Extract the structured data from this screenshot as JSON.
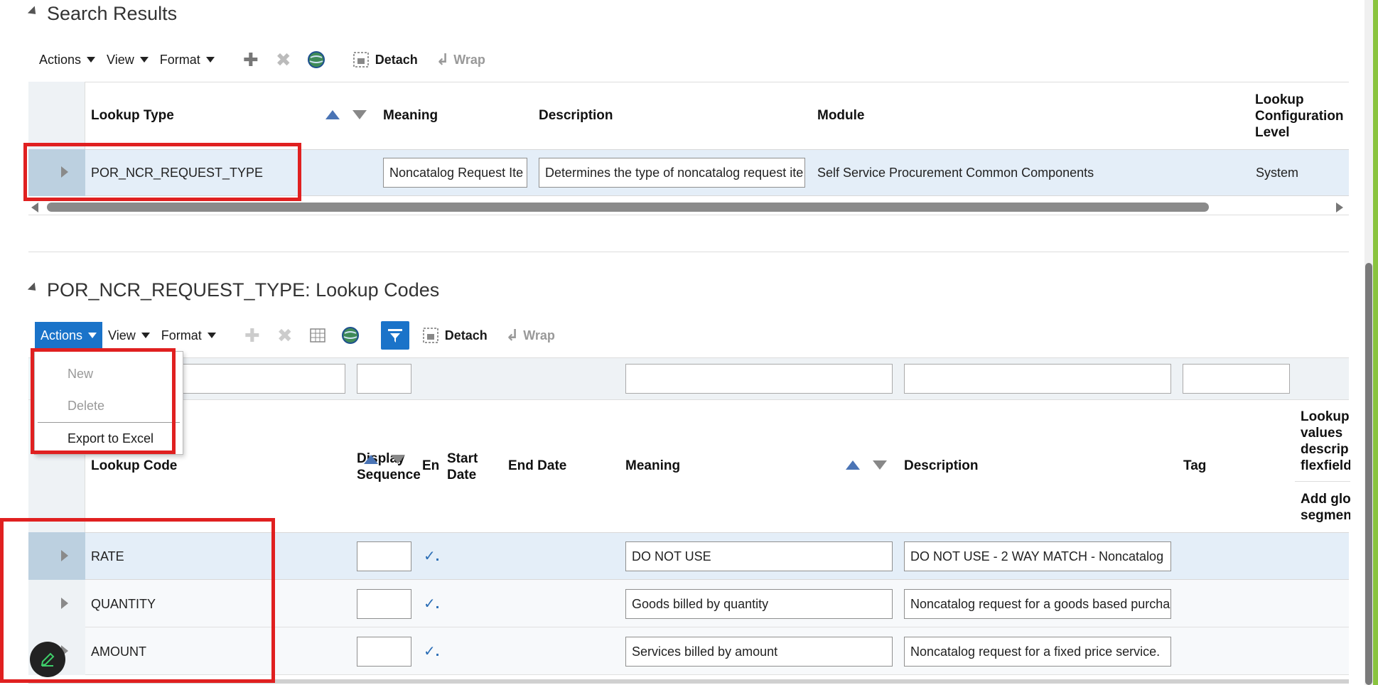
{
  "search_results": {
    "title": "Search Results",
    "toolbar": {
      "actions": "Actions",
      "view": "View",
      "format": "Format",
      "detach": "Detach",
      "wrap": "Wrap"
    },
    "columns": {
      "lookup_type": "Lookup Type",
      "meaning": "Meaning",
      "description": "Description",
      "module": "Module",
      "level_1": "Lookup",
      "level_2": "Configuration",
      "level_3": "Level"
    },
    "row": {
      "lookup_type": "POR_NCR_REQUEST_TYPE",
      "meaning": "Noncatalog Request Ite",
      "description": "Determines the type of noncatalog request ite",
      "module": "Self Service Procurement Common Components",
      "level": "System"
    }
  },
  "lookup_codes": {
    "title": "POR_NCR_REQUEST_TYPE: Lookup Codes",
    "toolbar": {
      "actions": "Actions",
      "view": "View",
      "format": "Format",
      "detach": "Detach",
      "wrap": "Wrap"
    },
    "actions_menu": {
      "new": "New",
      "delete": "Delete",
      "export": "Export to Excel"
    },
    "columns": {
      "lookup_code": "Lookup Code",
      "display_seq_1": "Display",
      "display_seq_2": "Sequence",
      "enabled": "En",
      "start_date_1": "Start",
      "start_date_2": "Date",
      "end_date": "End Date",
      "meaning": "Meaning",
      "description": "Description",
      "tag": "Tag",
      "flex_1": "Lookup",
      "flex_2": "values",
      "flex_3": "descrip",
      "flex_4": "flexfield",
      "flex_5": "Add glo",
      "flex_6": "segmen"
    },
    "rows": [
      {
        "code": "RATE",
        "enabled": "✓.",
        "meaning": "DO NOT USE",
        "description": "DO NOT USE - 2 WAY MATCH - Noncatalog"
      },
      {
        "code": "QUANTITY",
        "enabled": "✓.",
        "meaning": "Goods billed by quantity",
        "description": "Noncatalog request for a goods based purcha"
      },
      {
        "code": "AMOUNT",
        "enabled": "✓.",
        "meaning": "Services billed by amount",
        "description": "Noncatalog request for a fixed price service."
      }
    ]
  },
  "colors": {
    "selected_row": "#e4eef8",
    "handle": "#bcd0e0",
    "active_button": "#1a73c9",
    "highlight": "#e02020",
    "accent_bar": "#8ac43f"
  }
}
